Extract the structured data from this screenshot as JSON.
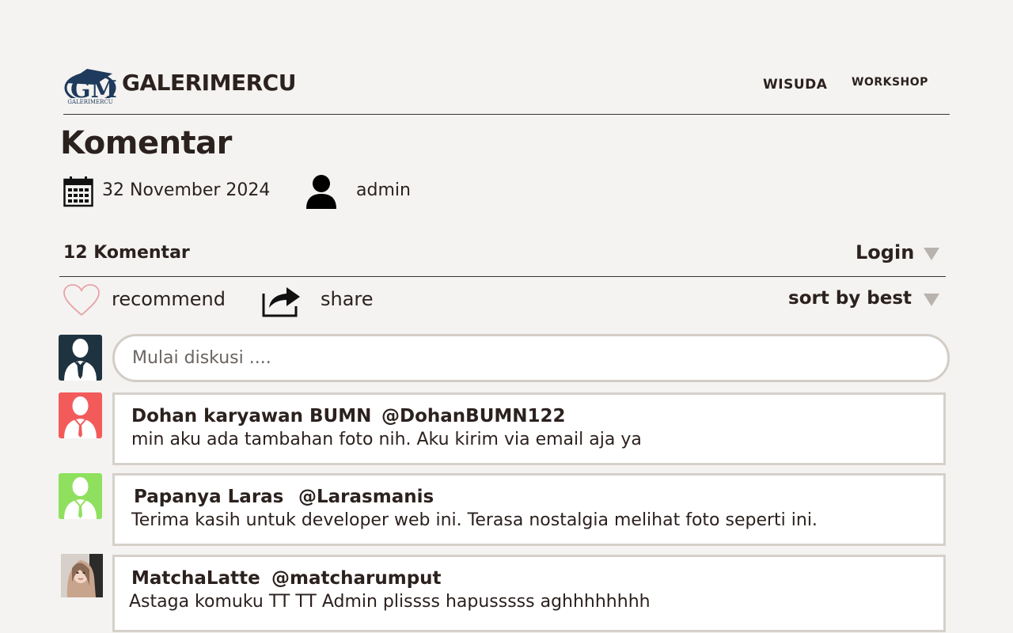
{
  "header": {
    "brand": "GALERIMERCU",
    "logo_text": "GALERIMERCU",
    "nav": [
      {
        "label": "WISUDA"
      },
      {
        "label": "WORKSHOP"
      }
    ]
  },
  "post": {
    "title": "Komentar",
    "date": "32 November 2024",
    "author": "admin"
  },
  "comments_bar": {
    "count_label": "12 Komentar",
    "login_label": "Login",
    "recommend_label": "recommend",
    "share_label": "share",
    "sort_label": "sort by best"
  },
  "composer": {
    "placeholder": "Mulai diskusi ...."
  },
  "comments": [
    {
      "name": "Dohan karyawan BUMN",
      "handle": "@DohanBUMN122",
      "text": "min aku ada tambahan foto nih. Aku kirim via email aja ya",
      "avatar_color": "#f35b5b"
    },
    {
      "name": "Papanya Laras",
      "handle": "@Larasmanis",
      "text": "Terima kasih untuk developer web ini. Terasa nostalgia melihat foto seperti ini.",
      "avatar_color": "#8fe05e"
    },
    {
      "name": "MatchaLatte",
      "handle": "@matcharumput",
      "text": "Astaga komuku TT TT Admin plissss hapusssss aghhhhhhhh",
      "avatar_color": "photo"
    }
  ],
  "colors": {
    "background": "#f4f3f1",
    "text": "#2b211e",
    "self_avatar": "#1f3240",
    "heart_outline": "#e7a3a8",
    "card_border": "#d6d0cb"
  }
}
